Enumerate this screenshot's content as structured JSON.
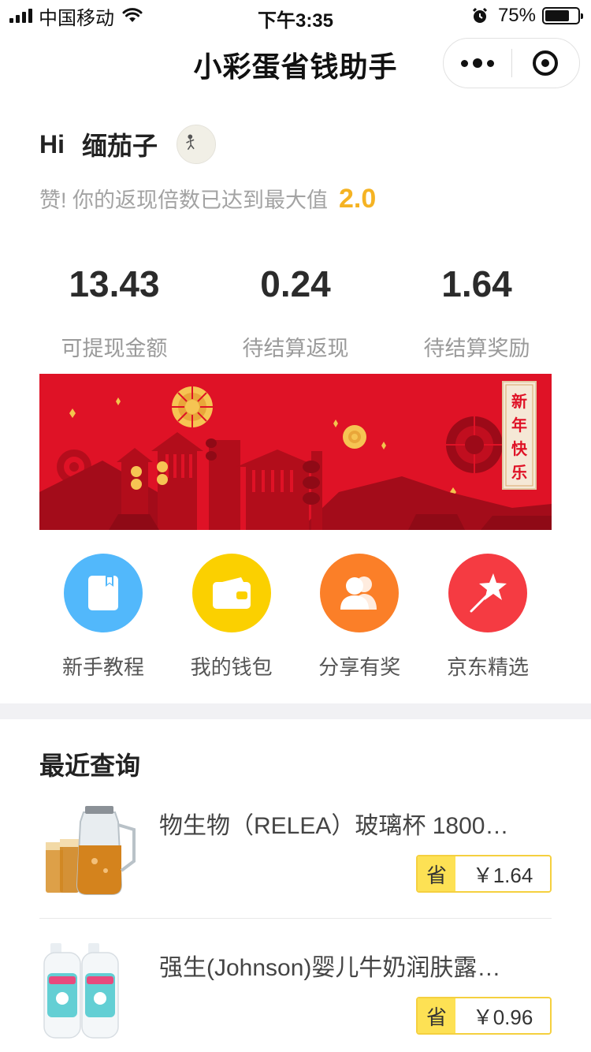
{
  "status_bar": {
    "carrier": "中国移动",
    "time": "下午3:35",
    "battery_percent": "75%",
    "battery_level": 0.75
  },
  "nav": {
    "title": "小彩蛋省钱助手"
  },
  "user": {
    "hi": "Hi",
    "name": "缅茄子",
    "cashback_text": "赞! 你的返现倍数已达到最大值",
    "multiplier": "2.0"
  },
  "stats": [
    {
      "value": "13.43",
      "label": "可提现金额"
    },
    {
      "value": "0.24",
      "label": "待结算返现"
    },
    {
      "value": "1.64",
      "label": "待结算奖励"
    }
  ],
  "banner": {
    "text_chars": [
      "新",
      "年",
      "快",
      "乐"
    ]
  },
  "actions": [
    {
      "label": "新手教程",
      "icon": "book-icon",
      "color": "#52b8fb"
    },
    {
      "label": "我的钱包",
      "icon": "wallet-icon",
      "color": "#fbd000"
    },
    {
      "label": "分享有奖",
      "icon": "users-icon",
      "color": "#fb7f28"
    },
    {
      "label": "京东精选",
      "icon": "star-wand-icon",
      "color": "#f53b42"
    }
  ],
  "recent": {
    "title": "最近查询",
    "items": [
      {
        "title": "物生物（RELEA）玻璃杯 1800…",
        "save_label": "省",
        "save_amount": "￥1.64",
        "image": "glass-pitcher-image"
      },
      {
        "title": "强生(Johnson)婴儿牛奶润肤露…",
        "save_label": "省",
        "save_amount": "￥0.96",
        "image": "lotion-bottles-image"
      }
    ]
  },
  "colors": {
    "accent_yellow": "#f5b323",
    "banner_red": "#df1226",
    "tag_yellow": "#fde154"
  }
}
